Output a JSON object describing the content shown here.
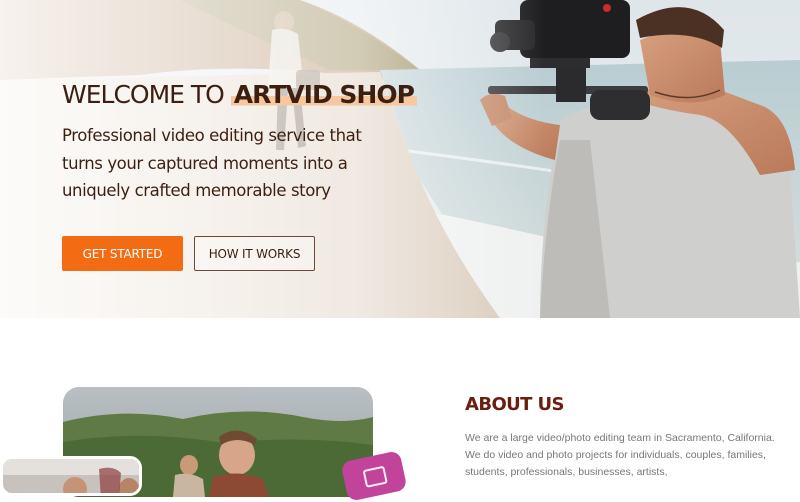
{
  "hero": {
    "title_prefix": "WELCOME TO",
    "title_brand": "ARTVID SHOP",
    "subtitle": "Professional video editing service that turns your captured moments into a uniquely crafted memorable story",
    "primary_button": "GET STARTED",
    "secondary_button": "HOW IT WORKS"
  },
  "about": {
    "title": "ABOUT US",
    "text": "We are a large video/photo editing team in Sacramento, California. We do video and photo projects for individuals, couples, families, students, professionals, businesses, artists,"
  },
  "colors": {
    "accent": "#f36b12",
    "heading_dark": "#3d1f10",
    "about_title": "#6a1d10",
    "body_text": "#777777",
    "pink_tile": "#c2449a"
  }
}
